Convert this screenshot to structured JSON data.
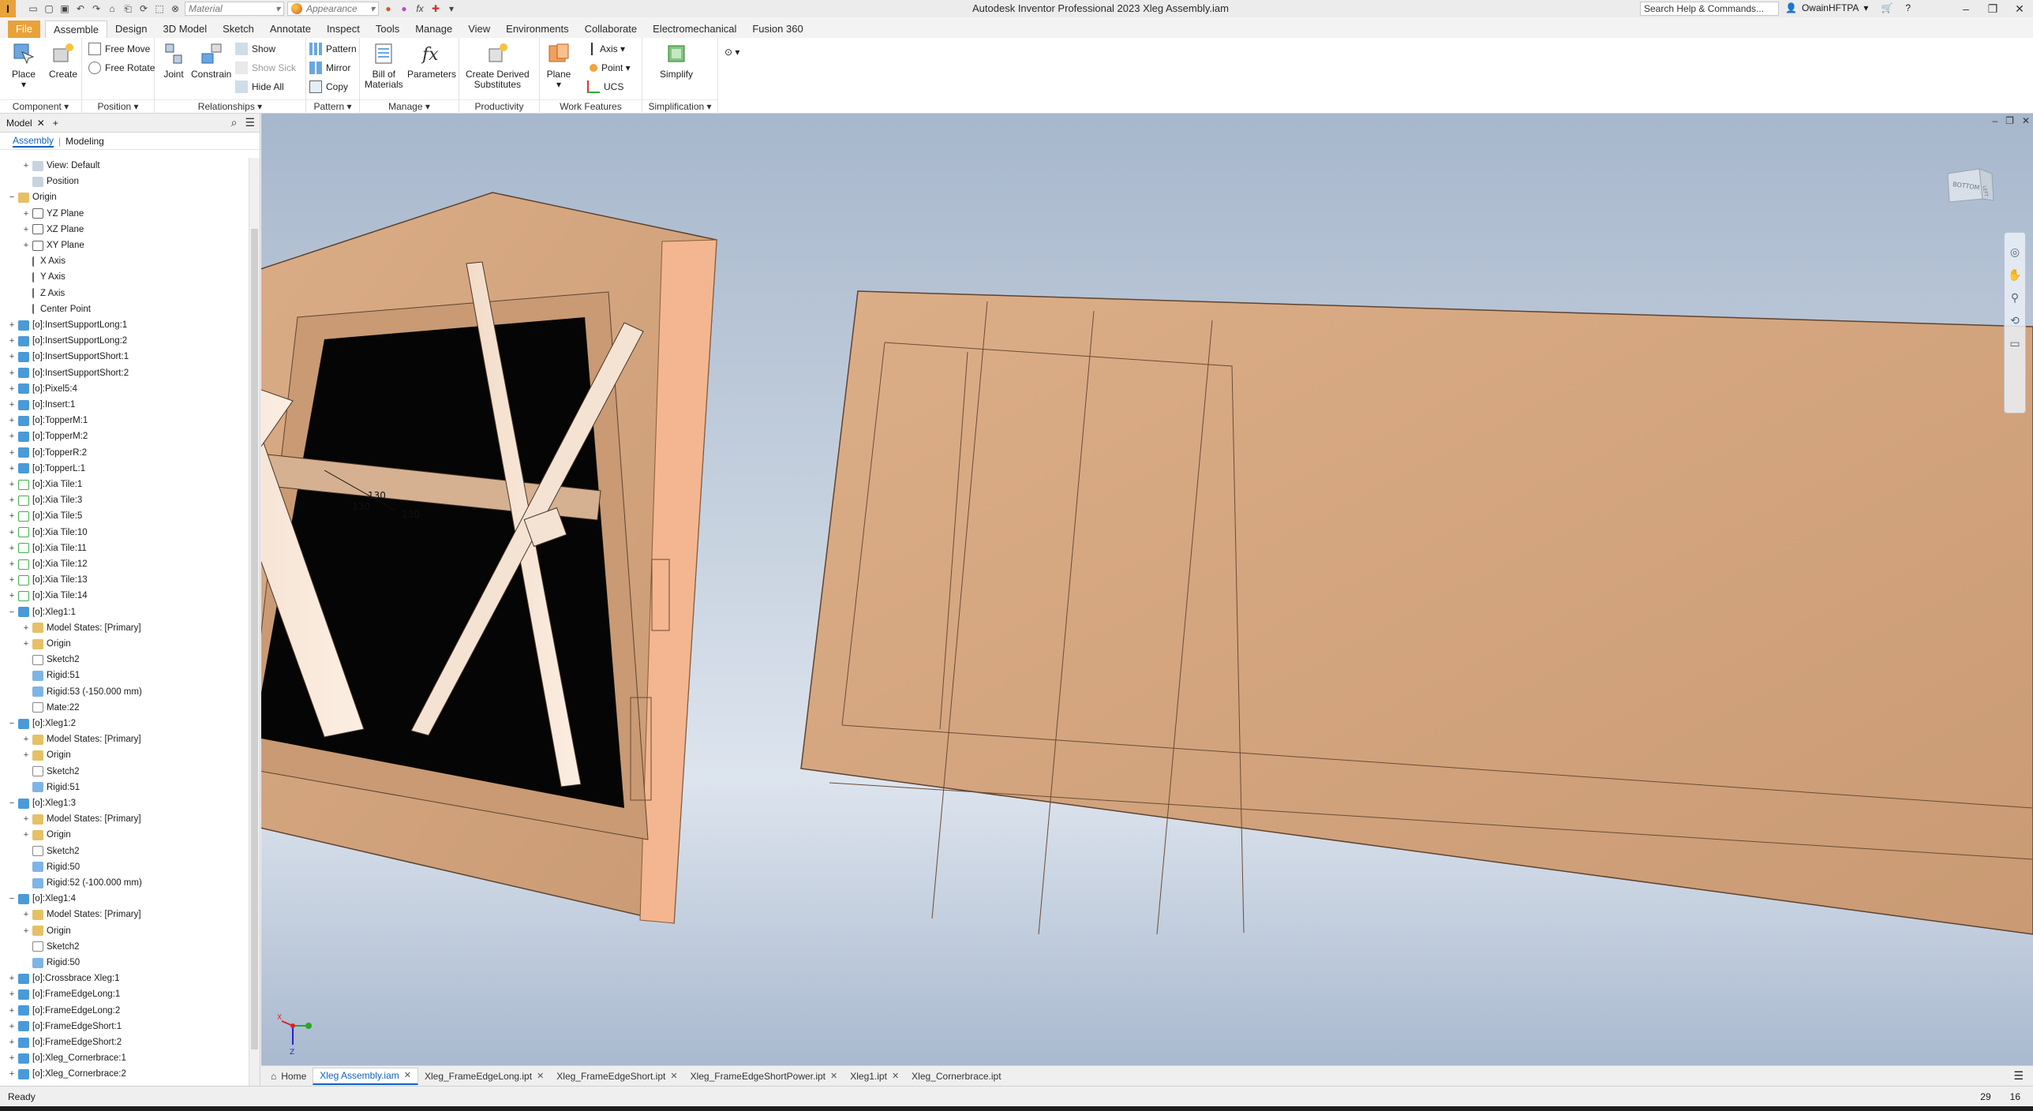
{
  "titlebar": {
    "app_logo": "I",
    "material_label": "Material",
    "appearance_label": "Appearance",
    "fx_label": "fx",
    "window_title": "Autodesk Inventor Professional 2023   Xleg Assembly.iam",
    "help_search": "Search Help & Commands...",
    "user_name": "OwainHFTPA"
  },
  "ribbon_tabs": [
    "File",
    "Assemble",
    "Design",
    "3D Model",
    "Sketch",
    "Annotate",
    "Inspect",
    "Tools",
    "Manage",
    "View",
    "Environments",
    "Collaborate",
    "Electromechanical",
    "Fusion 360"
  ],
  "ribbon": {
    "component": {
      "title": "Component ▾",
      "place": "Place",
      "create": "Create"
    },
    "position": {
      "title": "Position ▾",
      "free_move": "Free Move",
      "free_rotate": "Free Rotate"
    },
    "relationships": {
      "title": "Relationships ▾",
      "joint": "Joint",
      "constrain": "Constrain",
      "show": "Show",
      "show_sick": "Show Sick",
      "hide_all": "Hide All"
    },
    "pattern": {
      "title": "Pattern ▾",
      "pattern": "Pattern",
      "mirror": "Mirror",
      "copy": "Copy"
    },
    "manage": {
      "title": "Manage ▾",
      "bom_line1": "Bill of",
      "bom_line2": "Materials",
      "parameters": "Parameters"
    },
    "productivity": {
      "title": "Productivity",
      "derived_line1": "Create Derived",
      "derived_line2": "Substitutes"
    },
    "work_features": {
      "title": "Work Features",
      "plane": "Plane",
      "axis": "Axis ▾",
      "point": "Point ▾",
      "ucs": "UCS"
    },
    "simplification": {
      "title": "Simplification ▾",
      "simplify": "Simplify"
    }
  },
  "browser": {
    "tab_label": "Model",
    "mode_assembly": "Assembly",
    "mode_modeling": "Modeling",
    "tree": [
      {
        "label": "View: Default",
        "indent": 1,
        "exp": "+",
        "icon": "view"
      },
      {
        "label": "Position",
        "indent": 1,
        "exp": "",
        "icon": "view"
      },
      {
        "label": "Origin",
        "indent": 0,
        "exp": "−",
        "icon": "folder"
      },
      {
        "label": "YZ Plane",
        "indent": 1,
        "exp": "+",
        "icon": "plane"
      },
      {
        "label": "XZ Plane",
        "indent": 1,
        "exp": "+",
        "icon": "plane"
      },
      {
        "label": "XY Plane",
        "indent": 1,
        "exp": "+",
        "icon": "plane"
      },
      {
        "label": "X Axis",
        "indent": 1,
        "exp": "",
        "icon": "axis"
      },
      {
        "label": "Y Axis",
        "indent": 1,
        "exp": "",
        "icon": "axis"
      },
      {
        "label": "Z Axis",
        "indent": 1,
        "exp": "",
        "icon": "axis"
      },
      {
        "label": "Center Point",
        "indent": 1,
        "exp": "",
        "icon": "axis"
      },
      {
        "label": "[o]:InsertSupportLong:1",
        "indent": 0,
        "exp": "+",
        "icon": "part"
      },
      {
        "label": "[o]:InsertSupportLong:2",
        "indent": 0,
        "exp": "+",
        "icon": "part"
      },
      {
        "label": "[o]:InsertSupportShort:1",
        "indent": 0,
        "exp": "+",
        "icon": "part"
      },
      {
        "label": "[o]:InsertSupportShort:2",
        "indent": 0,
        "exp": "+",
        "icon": "part"
      },
      {
        "label": "[o]:Pixel5:4",
        "indent": 0,
        "exp": "+",
        "icon": "part"
      },
      {
        "label": "[o]:Insert:1",
        "indent": 0,
        "exp": "+",
        "icon": "part"
      },
      {
        "label": "[o]:TopperM:1",
        "indent": 0,
        "exp": "+",
        "icon": "part"
      },
      {
        "label": "[o]:TopperM:2",
        "indent": 0,
        "exp": "+",
        "icon": "part"
      },
      {
        "label": "[o]:TopperR:2",
        "indent": 0,
        "exp": "+",
        "icon": "part"
      },
      {
        "label": "[o]:TopperL:1",
        "indent": 0,
        "exp": "+",
        "icon": "part"
      },
      {
        "label": "[o]:Xia Tile:1",
        "indent": 0,
        "exp": "+",
        "icon": "tile"
      },
      {
        "label": "[o]:Xia Tile:3",
        "indent": 0,
        "exp": "+",
        "icon": "tile"
      },
      {
        "label": "[o]:Xia Tile:5",
        "indent": 0,
        "exp": "+",
        "icon": "tile"
      },
      {
        "label": "[o]:Xia Tile:10",
        "indent": 0,
        "exp": "+",
        "icon": "tile"
      },
      {
        "label": "[o]:Xia Tile:11",
        "indent": 0,
        "exp": "+",
        "icon": "tile"
      },
      {
        "label": "[o]:Xia Tile:12",
        "indent": 0,
        "exp": "+",
        "icon": "tile"
      },
      {
        "label": "[o]:Xia Tile:13",
        "indent": 0,
        "exp": "+",
        "icon": "tile"
      },
      {
        "label": "[o]:Xia Tile:14",
        "indent": 0,
        "exp": "+",
        "icon": "tile"
      },
      {
        "label": "[o]:Xleg1:1",
        "indent": 0,
        "exp": "−",
        "icon": "part"
      },
      {
        "label": "Model States: [Primary]",
        "indent": 1,
        "exp": "+",
        "icon": "folder"
      },
      {
        "label": "Origin",
        "indent": 1,
        "exp": "+",
        "icon": "folder"
      },
      {
        "label": "Sketch2",
        "indent": 1,
        "exp": "",
        "icon": "sketch"
      },
      {
        "label": "Rigid:51",
        "indent": 1,
        "exp": "",
        "icon": "constraint"
      },
      {
        "label": "Rigid:53 (-150.000 mm)",
        "indent": 1,
        "exp": "",
        "icon": "constraint"
      },
      {
        "label": "Mate:22",
        "indent": 1,
        "exp": "",
        "icon": "sketch"
      },
      {
        "label": "[o]:Xleg1:2",
        "indent": 0,
        "exp": "−",
        "icon": "part"
      },
      {
        "label": "Model States: [Primary]",
        "indent": 1,
        "exp": "+",
        "icon": "folder"
      },
      {
        "label": "Origin",
        "indent": 1,
        "exp": "+",
        "icon": "folder"
      },
      {
        "label": "Sketch2",
        "indent": 1,
        "exp": "",
        "icon": "sketch"
      },
      {
        "label": "Rigid:51",
        "indent": 1,
        "exp": "",
        "icon": "constraint"
      },
      {
        "label": "[o]:Xleg1:3",
        "indent": 0,
        "exp": "−",
        "icon": "part"
      },
      {
        "label": "Model States: [Primary]",
        "indent": 1,
        "exp": "+",
        "icon": "folder"
      },
      {
        "label": "Origin",
        "indent": 1,
        "exp": "+",
        "icon": "folder"
      },
      {
        "label": "Sketch2",
        "indent": 1,
        "exp": "",
        "icon": "sketch"
      },
      {
        "label": "Rigid:50",
        "indent": 1,
        "exp": "",
        "icon": "constraint"
      },
      {
        "label": "Rigid:52 (-100.000 mm)",
        "indent": 1,
        "exp": "",
        "icon": "constraint"
      },
      {
        "label": "[o]:Xleg1:4",
        "indent": 0,
        "exp": "−",
        "icon": "part"
      },
      {
        "label": "Model States: [Primary]",
        "indent": 1,
        "exp": "+",
        "icon": "folder"
      },
      {
        "label": "Origin",
        "indent": 1,
        "exp": "+",
        "icon": "folder"
      },
      {
        "label": "Sketch2",
        "indent": 1,
        "exp": "",
        "icon": "sketch"
      },
      {
        "label": "Rigid:50",
        "indent": 1,
        "exp": "",
        "icon": "constraint"
      },
      {
        "label": "[o]:Crossbrace Xleg:1",
        "indent": 0,
        "exp": "+",
        "icon": "part"
      },
      {
        "label": "[o]:FrameEdgeLong:1",
        "indent": 0,
        "exp": "+",
        "icon": "part"
      },
      {
        "label": "[o]:FrameEdgeLong:2",
        "indent": 0,
        "exp": "+",
        "icon": "part"
      },
      {
        "label": "[o]:FrameEdgeShort:1",
        "indent": 0,
        "exp": "+",
        "icon": "part"
      },
      {
        "label": "[o]:FrameEdgeShort:2",
        "indent": 0,
        "exp": "+",
        "icon": "part"
      },
      {
        "label": "[o]:Xleg_Cornerbrace:1",
        "indent": 0,
        "exp": "+",
        "icon": "part"
      },
      {
        "label": "[o]:Xleg_Cornerbrace:2",
        "indent": 0,
        "exp": "+",
        "icon": "part"
      }
    ]
  },
  "viewport": {
    "dim_1": "130",
    "dim_2": "130",
    "dim_3": "130",
    "viewcube_front": "BOTTOM",
    "viewcube_side": "LEFT",
    "triad_x": "X",
    "triad_z": "Z"
  },
  "doc_tabs": [
    {
      "label": "Home",
      "active": false,
      "close": false
    },
    {
      "label": "Xleg Assembly.iam",
      "active": true,
      "close": true
    },
    {
      "label": "Xleg_FrameEdgeLong.ipt",
      "active": false,
      "close": true
    },
    {
      "label": "Xleg_FrameEdgeShort.ipt",
      "active": false,
      "close": true
    },
    {
      "label": "Xleg_FrameEdgeShortPower.ipt",
      "active": false,
      "close": true
    },
    {
      "label": "Xleg1.ipt",
      "active": false,
      "close": true
    },
    {
      "label": "Xleg_Cornerbrace.ipt",
      "active": false,
      "close": false
    }
  ],
  "status": {
    "text": "Ready",
    "num1": "29",
    "num2": "16"
  }
}
